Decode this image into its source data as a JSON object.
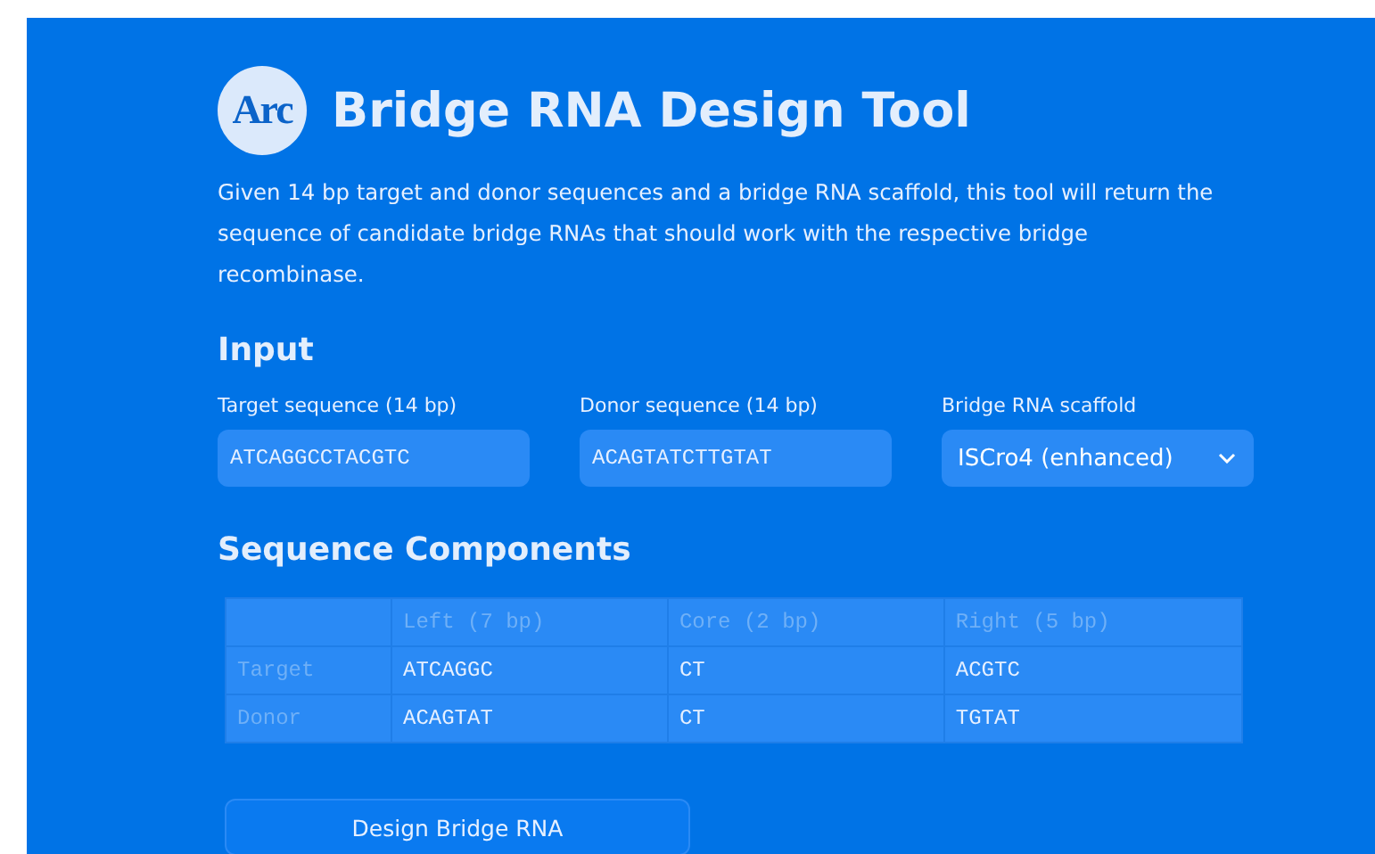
{
  "header": {
    "logo": "Arc",
    "title": "Bridge RNA Design Tool",
    "description": "Given 14 bp target and donor sequences and a bridge RNA scaffold, this tool will return the sequence of candidate bridge RNAs that should work with the respective bridge recombinase."
  },
  "input": {
    "heading": "Input",
    "fields": [
      {
        "kind": "text",
        "label": "Target sequence (14 bp)",
        "value": "ATCAGGCCTACGTC"
      },
      {
        "kind": "text",
        "label": "Donor sequence (14 bp)",
        "value": "ACAGTATCTTGTAT"
      },
      {
        "kind": "select",
        "label": "Bridge RNA scaffold",
        "value": "ISCro4 (enhanced)"
      }
    ]
  },
  "components": {
    "heading": "Sequence Components",
    "columns": [
      "Left (7 bp)",
      "Core (2 bp)",
      "Right (5 bp)"
    ],
    "rows": [
      {
        "label": "Target",
        "cells": [
          "ATCAGGC",
          "CT",
          "ACGTC"
        ]
      },
      {
        "label": "Donor",
        "cells": [
          "ACAGTAT",
          "CT",
          "TGTAT"
        ]
      }
    ]
  },
  "button": "Design Bridge RNA"
}
